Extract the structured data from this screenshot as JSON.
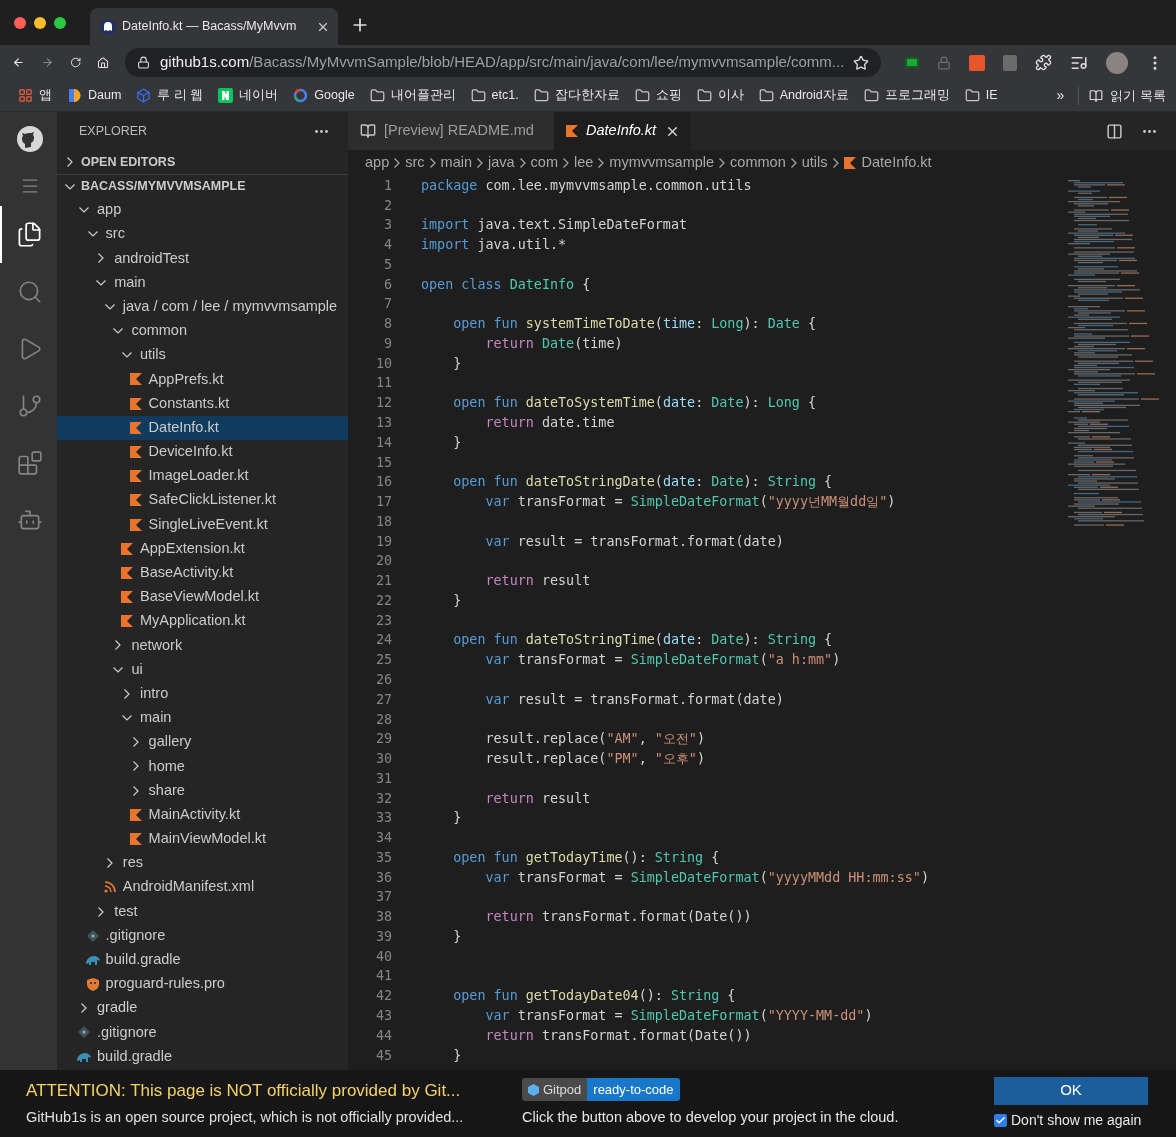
{
  "browser": {
    "tab": {
      "title": "DateInfo.kt — Bacass/MyMvvm",
      "selected": true
    },
    "address": {
      "host": "github1s.com",
      "path": "/Bacass/MyMvvmSample/blob/HEAD/app/src/main/java/com/lee/mymvvmsample/comm..."
    },
    "bookmarks": [
      {
        "label": "앱",
        "kind": "apps"
      },
      {
        "label": "Daum",
        "kind": "site"
      },
      {
        "label": "루 리 웹",
        "kind": "site"
      },
      {
        "label": "네이버",
        "kind": "site"
      },
      {
        "label": "Google",
        "kind": "site"
      },
      {
        "label": "내어플관리",
        "kind": "folder"
      },
      {
        "label": "etc1.",
        "kind": "folder"
      },
      {
        "label": "잡다한자료",
        "kind": "folder"
      },
      {
        "label": "쇼핑",
        "kind": "folder"
      },
      {
        "label": "이사",
        "kind": "folder"
      },
      {
        "label": "Android자료",
        "kind": "folder"
      },
      {
        "label": "프로그래밍",
        "kind": "folder"
      },
      {
        "label": "IE",
        "kind": "folder"
      }
    ],
    "more": "»",
    "reading_list": "읽기 목록"
  },
  "activity_bar": [
    {
      "kind": "github",
      "selected": false
    },
    {
      "kind": "menu",
      "selected": false
    },
    {
      "kind": "files",
      "selected": true
    },
    {
      "kind": "search",
      "selected": false
    },
    {
      "kind": "debug",
      "selected": false
    },
    {
      "kind": "scm",
      "selected": false
    },
    {
      "kind": "extensions",
      "selected": false
    },
    {
      "kind": "robot",
      "selected": false
    }
  ],
  "explorer": {
    "title": "EXPLORER",
    "sections": [
      {
        "label": "OPEN EDITORS",
        "expanded": false
      },
      {
        "label": "BACASS/MYMVVMSAMPLE",
        "expanded": true,
        "items": [
          {
            "label": "app",
            "kind": "folder",
            "expanded": true,
            "selected": false,
            "children": [
              {
                "label": "src",
                "kind": "folder",
                "expanded": true,
                "selected": false,
                "children": [
                  {
                    "label": "androidTest",
                    "kind": "folder",
                    "expanded": false,
                    "selected": false
                  },
                  {
                    "label": "main",
                    "kind": "folder",
                    "expanded": true,
                    "selected": false,
                    "children": [
                      {
                        "label": "java / com / lee / mymvvmsample",
                        "kind": "folder",
                        "expanded": true,
                        "selected": false,
                        "children": [
                          {
                            "label": "common",
                            "kind": "folder",
                            "expanded": true,
                            "selected": false,
                            "children": [
                              {
                                "label": "utils",
                                "kind": "folder",
                                "expanded": true,
                                "selected": false,
                                "children": [
                                  {
                                    "label": "AppPrefs.kt",
                                    "kind": "kotlin",
                                    "selected": false
                                  },
                                  {
                                    "label": "Constants.kt",
                                    "kind": "kotlin",
                                    "selected": false
                                  },
                                  {
                                    "label": "DateInfo.kt",
                                    "kind": "kotlin",
                                    "selected": true
                                  },
                                  {
                                    "label": "DeviceInfo.kt",
                                    "kind": "kotlin",
                                    "selected": false
                                  },
                                  {
                                    "label": "ImageLoader.kt",
                                    "kind": "kotlin",
                                    "selected": false
                                  },
                                  {
                                    "label": "SafeClickListener.kt",
                                    "kind": "kotlin",
                                    "selected": false
                                  },
                                  {
                                    "label": "SingleLiveEvent.kt",
                                    "kind": "kotlin",
                                    "selected": false
                                  }
                                ]
                              },
                              {
                                "label": "AppExtension.kt",
                                "kind": "kotlin",
                                "selected": false
                              },
                              {
                                "label": "BaseActivity.kt",
                                "kind": "kotlin",
                                "selected": false
                              },
                              {
                                "label": "BaseViewModel.kt",
                                "kind": "kotlin",
                                "selected": false
                              },
                              {
                                "label": "MyApplication.kt",
                                "kind": "kotlin",
                                "selected": false
                              }
                            ]
                          },
                          {
                            "label": "network",
                            "kind": "folder",
                            "expanded": false,
                            "selected": false
                          },
                          {
                            "label": "ui",
                            "kind": "folder",
                            "expanded": true,
                            "selected": false,
                            "children": [
                              {
                                "label": "intro",
                                "kind": "folder",
                                "expanded": false,
                                "selected": false
                              },
                              {
                                "label": "main",
                                "kind": "folder",
                                "expanded": true,
                                "selected": false,
                                "children": [
                                  {
                                    "label": "gallery",
                                    "kind": "folder",
                                    "expanded": false,
                                    "selected": false
                                  },
                                  {
                                    "label": "home",
                                    "kind": "folder",
                                    "expanded": false,
                                    "selected": false
                                  },
                                  {
                                    "label": "share",
                                    "kind": "folder",
                                    "expanded": false,
                                    "selected": false
                                  },
                                  {
                                    "label": "MainActivity.kt",
                                    "kind": "kotlin",
                                    "selected": false
                                  },
                                  {
                                    "label": "MainViewModel.kt",
                                    "kind": "kotlin",
                                    "selected": false
                                  }
                                ]
                              }
                            ]
                          }
                        ]
                      },
                      {
                        "label": "res",
                        "kind": "folder",
                        "expanded": false,
                        "selected": false
                      },
                      {
                        "label": "AndroidManifest.xml",
                        "kind": "xml",
                        "selected": false
                      }
                    ]
                  },
                  {
                    "label": "test",
                    "kind": "folder",
                    "expanded": false,
                    "selected": false
                  }
                ]
              },
              {
                "label": ".gitignore",
                "kind": "git",
                "selected": false
              },
              {
                "label": "build.gradle",
                "kind": "gradle",
                "selected": false
              },
              {
                "label": "proguard-rules.pro",
                "kind": "proguard",
                "selected": false
              }
            ]
          },
          {
            "label": "gradle",
            "kind": "folder",
            "expanded": false,
            "selected": false
          },
          {
            "label": ".gitignore",
            "kind": "git",
            "selected": false
          },
          {
            "label": "build.gradle",
            "kind": "gradle",
            "selected": false
          }
        ]
      }
    ]
  },
  "editor": {
    "tabs": [
      {
        "label": "[Preview] README.md",
        "kind": "preview",
        "selected": false
      },
      {
        "label": "DateInfo.kt",
        "kind": "kotlin",
        "selected": true
      }
    ],
    "breadcrumbs": [
      {
        "label": "app",
        "kind": "folder"
      },
      {
        "label": "src",
        "kind": "folder"
      },
      {
        "label": "main",
        "kind": "folder"
      },
      {
        "label": "java",
        "kind": "folder"
      },
      {
        "label": "com",
        "kind": "folder"
      },
      {
        "label": "lee",
        "kind": "folder"
      },
      {
        "label": "mymvvmsample",
        "kind": "folder"
      },
      {
        "label": "common",
        "kind": "folder"
      },
      {
        "label": "utils",
        "kind": "folder"
      },
      {
        "label": "DateInfo.kt",
        "kind": "kotlin"
      }
    ],
    "lines": [
      {
        "n": "1",
        "tokens": [
          {
            "kind": "kw",
            "text": "package "
          },
          {
            "kind": "plain",
            "text": "com.lee.mymvvmsample.common.utils"
          }
        ]
      },
      {
        "n": "2"
      },
      {
        "n": "3",
        "tokens": [
          {
            "kind": "kw",
            "text": "import "
          },
          {
            "kind": "plain",
            "text": "java.text.SimpleDateFormat"
          }
        ]
      },
      {
        "n": "4",
        "tokens": [
          {
            "kind": "kw",
            "text": "import "
          },
          {
            "kind": "plain",
            "text": "java.util.*"
          }
        ]
      },
      {
        "n": "5"
      },
      {
        "n": "6",
        "tokens": [
          {
            "kind": "kw",
            "text": "open class "
          },
          {
            "kind": "type",
            "text": "DateInfo"
          },
          {
            "kind": "plain",
            "text": " {"
          }
        ]
      },
      {
        "n": "7"
      },
      {
        "n": "8",
        "tokens": [
          {
            "kind": "kw",
            "text": "    open fun "
          },
          {
            "kind": "fn",
            "text": "systemTimeToDate"
          },
          {
            "kind": "plain",
            "text": "("
          },
          {
            "kind": "param",
            "text": "time"
          },
          {
            "kind": "plain",
            "text": ": "
          },
          {
            "kind": "type",
            "text": "Long"
          },
          {
            "kind": "plain",
            "text": "): "
          },
          {
            "kind": "type",
            "text": "Date"
          },
          {
            "kind": "plain",
            "text": " {"
          }
        ]
      },
      {
        "n": "9",
        "tokens": [
          {
            "kind": "ctl",
            "text": "        return "
          },
          {
            "kind": "type",
            "text": "Date"
          },
          {
            "kind": "plain",
            "text": "(time)"
          }
        ]
      },
      {
        "n": "10",
        "tokens": [
          {
            "kind": "plain",
            "text": "    }"
          }
        ]
      },
      {
        "n": "11"
      },
      {
        "n": "12",
        "tokens": [
          {
            "kind": "kw",
            "text": "    open fun "
          },
          {
            "kind": "fn",
            "text": "dateToSystemTime"
          },
          {
            "kind": "plain",
            "text": "("
          },
          {
            "kind": "param",
            "text": "date"
          },
          {
            "kind": "plain",
            "text": ": "
          },
          {
            "kind": "type",
            "text": "Date"
          },
          {
            "kind": "plain",
            "text": "): "
          },
          {
            "kind": "type",
            "text": "Long"
          },
          {
            "kind": "plain",
            "text": " {"
          }
        ]
      },
      {
        "n": "13",
        "tokens": [
          {
            "kind": "ctl",
            "text": "        return "
          },
          {
            "kind": "plain",
            "text": "date.time"
          }
        ]
      },
      {
        "n": "14",
        "tokens": [
          {
            "kind": "plain",
            "text": "    }"
          }
        ]
      },
      {
        "n": "15"
      },
      {
        "n": "16",
        "tokens": [
          {
            "kind": "kw",
            "text": "    open fun "
          },
          {
            "kind": "fn",
            "text": "dateToStringDate"
          },
          {
            "kind": "plain",
            "text": "("
          },
          {
            "kind": "param",
            "text": "date"
          },
          {
            "kind": "plain",
            "text": ": "
          },
          {
            "kind": "type",
            "text": "Date"
          },
          {
            "kind": "plain",
            "text": "): "
          },
          {
            "kind": "type",
            "text": "String"
          },
          {
            "kind": "plain",
            "text": " {"
          }
        ]
      },
      {
        "n": "17",
        "tokens": [
          {
            "kind": "kw",
            "text": "        var "
          },
          {
            "kind": "plain",
            "text": "transFormat = "
          },
          {
            "kind": "type",
            "text": "SimpleDateFormat"
          },
          {
            "kind": "plain",
            "text": "("
          },
          {
            "kind": "str",
            "text": "\"yyyy년MM월dd일\""
          },
          {
            "kind": "plain",
            "text": ")"
          }
        ]
      },
      {
        "n": "18"
      },
      {
        "n": "19",
        "tokens": [
          {
            "kind": "kw",
            "text": "        var "
          },
          {
            "kind": "plain",
            "text": "result = transFormat.format(date)"
          }
        ]
      },
      {
        "n": "20"
      },
      {
        "n": "21",
        "tokens": [
          {
            "kind": "ctl",
            "text": "        return "
          },
          {
            "kind": "plain",
            "text": "result"
          }
        ]
      },
      {
        "n": "22",
        "tokens": [
          {
            "kind": "plain",
            "text": "    }"
          }
        ]
      },
      {
        "n": "23"
      },
      {
        "n": "24",
        "tokens": [
          {
            "kind": "kw",
            "text": "    open fun "
          },
          {
            "kind": "fn",
            "text": "dateToStringTime"
          },
          {
            "kind": "plain",
            "text": "("
          },
          {
            "kind": "param",
            "text": "date"
          },
          {
            "kind": "plain",
            "text": ": "
          },
          {
            "kind": "type",
            "text": "Date"
          },
          {
            "kind": "plain",
            "text": "): "
          },
          {
            "kind": "type",
            "text": "String"
          },
          {
            "kind": "plain",
            "text": " {"
          }
        ]
      },
      {
        "n": "25",
        "tokens": [
          {
            "kind": "kw",
            "text": "        var "
          },
          {
            "kind": "plain",
            "text": "transFormat = "
          },
          {
            "kind": "type",
            "text": "SimpleDateFormat"
          },
          {
            "kind": "plain",
            "text": "("
          },
          {
            "kind": "str",
            "text": "\"a h:mm\""
          },
          {
            "kind": "plain",
            "text": ")"
          }
        ]
      },
      {
        "n": "26"
      },
      {
        "n": "27",
        "tokens": [
          {
            "kind": "kw",
            "text": "        var "
          },
          {
            "kind": "plain",
            "text": "result = transFormat.format(date)"
          }
        ]
      },
      {
        "n": "28"
      },
      {
        "n": "29",
        "tokens": [
          {
            "kind": "plain",
            "text": "        result.replace("
          },
          {
            "kind": "str",
            "text": "\"AM\""
          },
          {
            "kind": "plain",
            "text": ", "
          },
          {
            "kind": "str",
            "text": "\"오전\""
          },
          {
            "kind": "plain",
            "text": ")"
          }
        ]
      },
      {
        "n": "30",
        "tokens": [
          {
            "kind": "plain",
            "text": "        result.replace("
          },
          {
            "kind": "str",
            "text": "\"PM\""
          },
          {
            "kind": "plain",
            "text": ", "
          },
          {
            "kind": "str",
            "text": "\"오후\""
          },
          {
            "kind": "plain",
            "text": ")"
          }
        ]
      },
      {
        "n": "31"
      },
      {
        "n": "32",
        "tokens": [
          {
            "kind": "ctl",
            "text": "        return "
          },
          {
            "kind": "plain",
            "text": "result"
          }
        ]
      },
      {
        "n": "33",
        "tokens": [
          {
            "kind": "plain",
            "text": "    }"
          }
        ]
      },
      {
        "n": "34"
      },
      {
        "n": "35",
        "tokens": [
          {
            "kind": "kw",
            "text": "    open fun "
          },
          {
            "kind": "fn",
            "text": "getTodayTime"
          },
          {
            "kind": "plain",
            "text": "(): "
          },
          {
            "kind": "type",
            "text": "String"
          },
          {
            "kind": "plain",
            "text": " {"
          }
        ]
      },
      {
        "n": "36",
        "tokens": [
          {
            "kind": "kw",
            "text": "        var "
          },
          {
            "kind": "plain",
            "text": "transFormat = "
          },
          {
            "kind": "type",
            "text": "SimpleDateFormat"
          },
          {
            "kind": "plain",
            "text": "("
          },
          {
            "kind": "str",
            "text": "\"yyyyMMdd HH:mm:ss\""
          },
          {
            "kind": "plain",
            "text": ")"
          }
        ]
      },
      {
        "n": "37"
      },
      {
        "n": "38",
        "tokens": [
          {
            "kind": "ctl",
            "text": "        return "
          },
          {
            "kind": "plain",
            "text": "transFormat.format(Date())"
          }
        ]
      },
      {
        "n": "39",
        "tokens": [
          {
            "kind": "plain",
            "text": "    }"
          }
        ]
      },
      {
        "n": "40"
      },
      {
        "n": "41"
      },
      {
        "n": "42",
        "tokens": [
          {
            "kind": "kw",
            "text": "    open fun "
          },
          {
            "kind": "fn",
            "text": "getTodayDate04"
          },
          {
            "kind": "plain",
            "text": "(): "
          },
          {
            "kind": "type",
            "text": "String"
          },
          {
            "kind": "plain",
            "text": " {"
          }
        ]
      },
      {
        "n": "43",
        "tokens": [
          {
            "kind": "kw",
            "text": "        var "
          },
          {
            "kind": "plain",
            "text": "transFormat = "
          },
          {
            "kind": "type",
            "text": "SimpleDateFormat"
          },
          {
            "kind": "plain",
            "text": "("
          },
          {
            "kind": "str",
            "text": "\"YYYY-MM-dd\""
          },
          {
            "kind": "plain",
            "text": ")"
          }
        ]
      },
      {
        "n": "44",
        "tokens": [
          {
            "kind": "ctl",
            "text": "        return "
          },
          {
            "kind": "plain",
            "text": "transFormat.format(Date())"
          }
        ]
      },
      {
        "n": "45",
        "tokens": [
          {
            "kind": "plain",
            "text": "    }"
          }
        ]
      }
    ]
  },
  "notice": {
    "title": "ATTENTION: This page is NOT officially provided by Git...",
    "text": "GitHub1s is an open source project, which is not officially provided...",
    "badge": {
      "name": "Gitpod",
      "status": "ready-to-code"
    },
    "hint": "Click the button above to develop your project in the cloud.",
    "ok": "OK",
    "dont_show": {
      "label": "Don't show me again",
      "checked": true
    }
  }
}
